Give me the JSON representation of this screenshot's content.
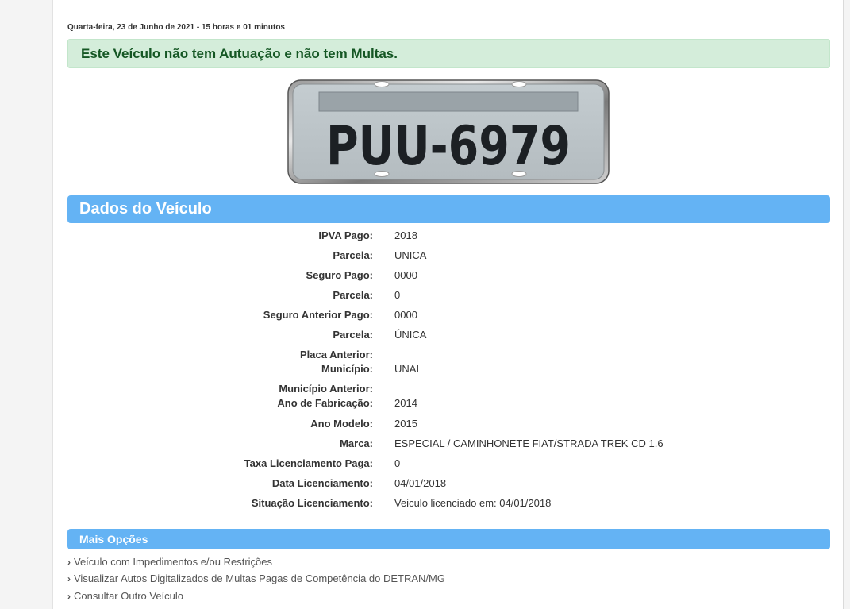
{
  "date_line": "Quarta-feira, 23 de Junho de 2021 - 15 horas e 01 minutos",
  "alert_message": "Este Veículo não tem Autuação e não tem Multas.",
  "plate": {
    "number": "PUU-6979"
  },
  "colors": {
    "accent": "#64b3f4",
    "alert_bg": "#d4edda",
    "alert_text": "#155724"
  },
  "dados": {
    "title": "Dados do Veículo",
    "rows": [
      {
        "label": "IPVA Pago:",
        "value": "2018"
      },
      {
        "label": "Parcela:",
        "value": "UNICA"
      },
      {
        "label": "Seguro Pago:",
        "value": "0000"
      },
      {
        "label": "Parcela:",
        "value": "0"
      },
      {
        "label": "Seguro Anterior Pago:",
        "value": "0000"
      },
      {
        "label": "Parcela:",
        "value": "ÚNICA"
      },
      {
        "label": "Placa Anterior:",
        "value": ""
      },
      {
        "label": "Município:",
        "value": "UNAI"
      },
      {
        "label": "Município Anterior:",
        "value": ""
      },
      {
        "label": "Ano de Fabricação:",
        "value": "2014"
      },
      {
        "label": "Ano Modelo:",
        "value": "2015"
      },
      {
        "label": "Marca:",
        "value": "ESPECIAL / CAMINHONETE FIAT/STRADA TREK CD 1.6"
      },
      {
        "label": "Taxa Licenciamento Paga:",
        "value": "0"
      },
      {
        "label": "Data Licenciamento:",
        "value": "04/01/2018"
      },
      {
        "label": "Situação Licenciamento:",
        "value": "Veiculo licenciado em: 04/01/2018"
      }
    ]
  },
  "mais_opcoes": {
    "title": "Mais Opções",
    "chevron": "›",
    "links": [
      "Veículo com Impedimentos e/ou Restrições",
      "Visualizar Autos Digitalizados de Multas Pagas de Competência do DETRAN/MG",
      "Consultar Outro Veículo"
    ]
  }
}
